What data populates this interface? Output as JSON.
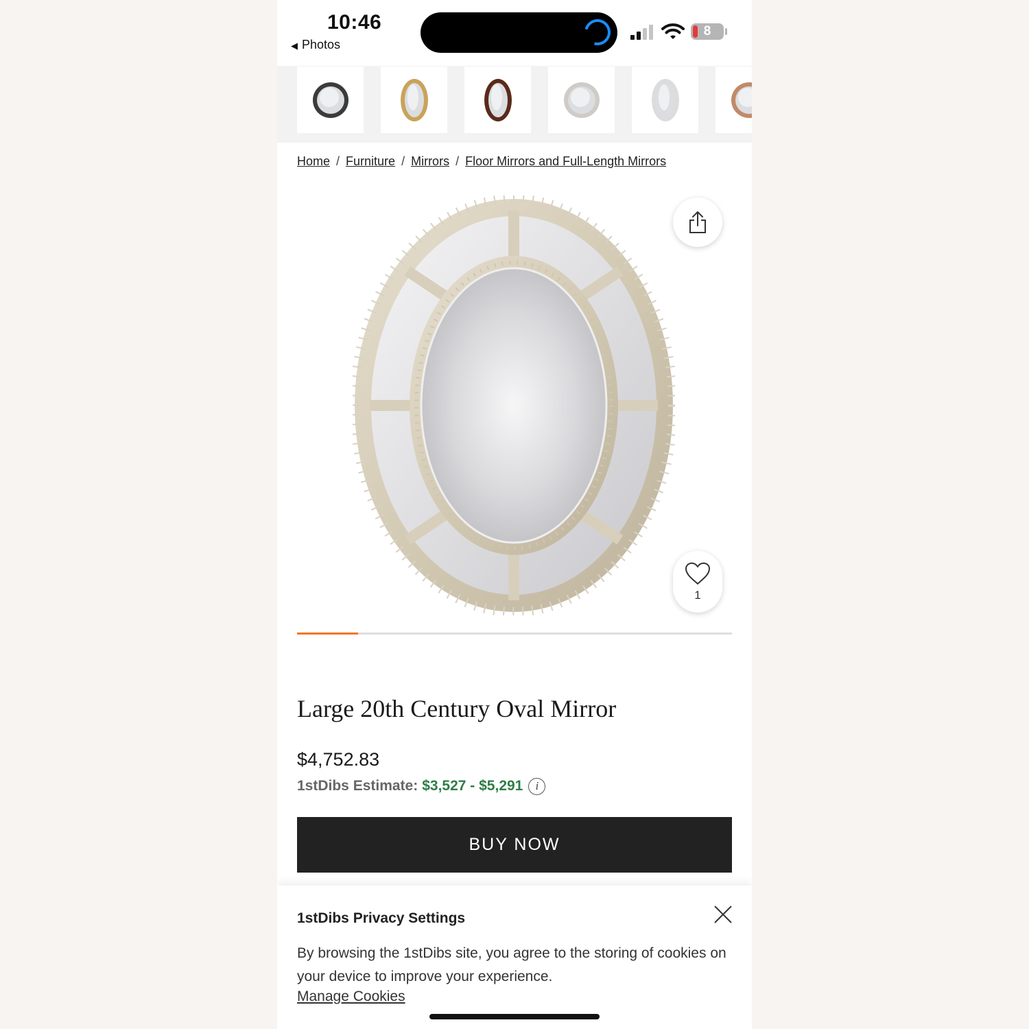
{
  "status_bar": {
    "time": "10:46",
    "back_app": "Photos",
    "battery_level": "8",
    "signal_bars_active": 2,
    "signal_bars_total": 4
  },
  "thumbnails": [
    {
      "name": "thumb-dark-sunburst-mirror",
      "frame_color": "#3b3b3b"
    },
    {
      "name": "thumb-gold-oval-mirror",
      "frame_color": "#c9a35a"
    },
    {
      "name": "thumb-mahogany-oval-mirror",
      "frame_color": "#5a2a1a"
    },
    {
      "name": "thumb-silver-round-mirror",
      "frame_color": "#cfcbc6"
    },
    {
      "name": "thumb-frameless-oval-mirror",
      "frame_color": "#dcdcdc"
    },
    {
      "name": "thumb-copper-round-mirror",
      "frame_color": "#c08a6a"
    }
  ],
  "breadcrumb": [
    "Home",
    "Furniture",
    "Mirrors",
    "Floor Mirrors and Full-Length Mirrors"
  ],
  "gallery": {
    "favorite_count": "1",
    "progress_fraction": 0.14
  },
  "product": {
    "title": "Large 20th Century Oval Mirror",
    "price": "$4,752.83",
    "estimate_label": "1stDibs Estimate:",
    "estimate_range": "$3,527 - $5,291",
    "info_icon": "i",
    "buy_label": "BUY NOW"
  },
  "privacy": {
    "title": "1stDibs Privacy Settings",
    "text": "By browsing the 1stDibs site, you agree to the storing of cookies on your device to improve your experience.",
    "link": "Manage Cookies"
  },
  "colors": {
    "accent_progress": "#f0782a",
    "estimate_green": "#2e7d46",
    "button_dark": "#222222"
  }
}
